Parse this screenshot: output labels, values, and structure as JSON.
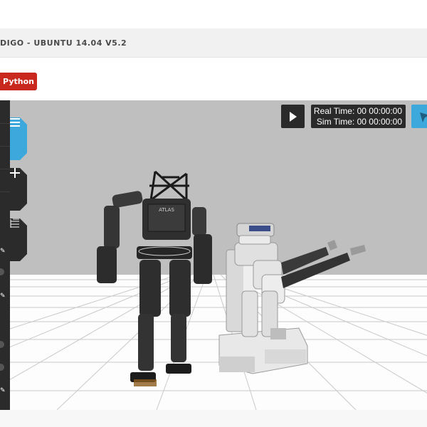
{
  "window": {
    "title": "DIGO - UBUNTU 14.04 V5.2"
  },
  "toolbar": {
    "python_label": "Python"
  },
  "viewport": {
    "play_icon": "play-icon",
    "real_time": "Real Time: 00 00:00:00",
    "sim_time": "Sim Time: 00 00:00:00",
    "robot_label": "ATLAS",
    "side_tabs": [
      "menu-icon",
      "plus-icon",
      "tree-icon"
    ]
  },
  "colors": {
    "python_button": "#c9281e",
    "accent_blue": "#3da8dc",
    "panel_dark": "#2b2b2b",
    "sky": "#bfbfbf"
  }
}
